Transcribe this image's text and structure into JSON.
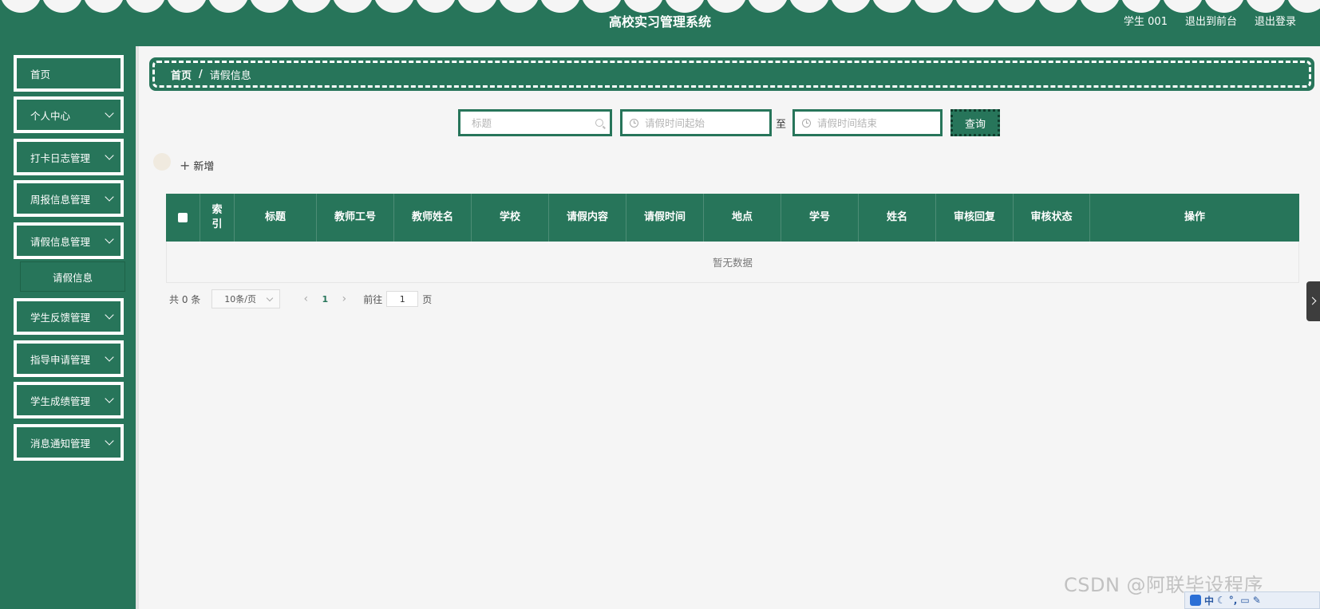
{
  "header": {
    "title": "高校实习管理系统",
    "user": "学生 001",
    "back_to_front": "退出到前台",
    "logout": "退出登录"
  },
  "sidebar": {
    "items": [
      {
        "label": "首页",
        "has_chevron": false
      },
      {
        "label": "个人中心",
        "has_chevron": true
      },
      {
        "label": "打卡日志管理",
        "has_chevron": true
      },
      {
        "label": "周报信息管理",
        "has_chevron": true
      },
      {
        "label": "请假信息管理",
        "has_chevron": true
      },
      {
        "label": "学生反馈管理",
        "has_chevron": true
      },
      {
        "label": "指导申请管理",
        "has_chevron": true
      },
      {
        "label": "学生成绩管理",
        "has_chevron": true
      },
      {
        "label": "消息通知管理",
        "has_chevron": true
      }
    ],
    "submenu_label": "请假信息"
  },
  "breadcrumb": {
    "home": "首页",
    "separator": "/",
    "current": "请假信息"
  },
  "search": {
    "title_placeholder": "标题",
    "start_placeholder": "请假时间起始",
    "range_separator": "至",
    "end_placeholder": "请假时间结束",
    "query_label": "查询"
  },
  "toolbar": {
    "add_label": "新增"
  },
  "table": {
    "columns": [
      "索引",
      "标题",
      "教师工号",
      "教师姓名",
      "学校",
      "请假内容",
      "请假时间",
      "地点",
      "学号",
      "姓名",
      "审核回复",
      "审核状态",
      "操作"
    ],
    "empty_text": "暂无数据"
  },
  "pagination": {
    "total_text": "共 0 条",
    "page_size": "10条/页",
    "current_page": "1",
    "goto_prefix": "前往",
    "goto_value": "1",
    "goto_suffix": "页"
  },
  "watermark": "CSDN @阿联毕设程序",
  "tray": {
    "ime_label": "中"
  },
  "colors": {
    "primary": "#27755a",
    "background": "#f5f5f5"
  }
}
